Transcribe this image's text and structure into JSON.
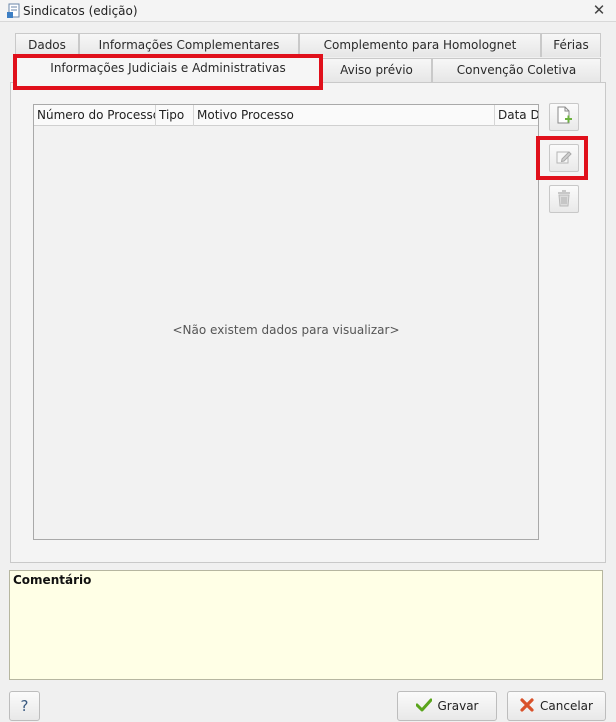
{
  "window": {
    "title": "Sindicatos (edição)",
    "close_glyph": "✕"
  },
  "tabs": {
    "row1": [
      "Dados",
      "Informações Complementares",
      "Complemento para Homolognet",
      "Férias"
    ],
    "row2": [
      "Informações Judiciais e Administrativas",
      "Aviso prévio",
      "Convenção Coletiva"
    ],
    "active": "Informações Judiciais e Administrativas"
  },
  "grid": {
    "columns": [
      "Número do Processo",
      "Tipo",
      "Motivo Processo",
      "Data Decisão"
    ],
    "empty_message": "<Não existem dados para visualizar>"
  },
  "side_buttons": {
    "icons": [
      "new-document-icon",
      "edit-icon",
      "trash-icon"
    ]
  },
  "comment": {
    "label": "Comentário",
    "value": ""
  },
  "footer": {
    "help_label": "?",
    "save_label": "Gravar",
    "cancel_label": "Cancelar"
  },
  "colors": {
    "highlight": "#e0101b",
    "comment_bg": "#ffffe6",
    "save_check": "#5aa51c",
    "cancel_x": "#d9522b"
  }
}
